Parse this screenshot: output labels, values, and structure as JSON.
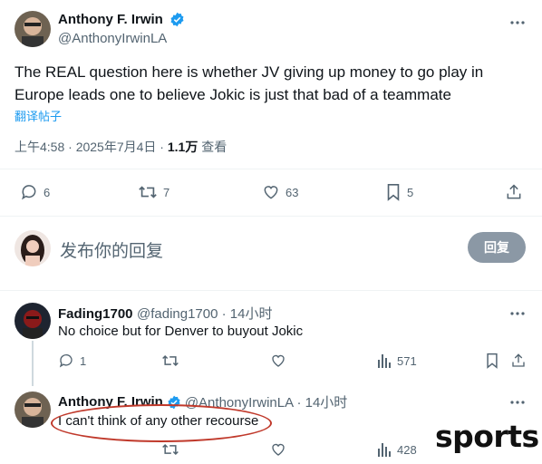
{
  "main_tweet": {
    "author": "Anthony F. Irwin",
    "handle": "@AnthonyIrwinLA",
    "text_line1": "The REAL question here is whether JV giving up money to go play in",
    "text_line2": "Europe leads one to believe Jokic is just that bad of a teammate",
    "translate": "翻译帖子",
    "time": "上午4:58 · 2025年7月4日 · ",
    "views": "1.1万",
    "views_label": " 查看",
    "stats": {
      "replies": "6",
      "retweets": "7",
      "likes": "63",
      "bookmarks": "5"
    }
  },
  "compose": {
    "placeholder": "发布你的回复",
    "button": "回复"
  },
  "reply1": {
    "author": "Fading1700",
    "handle_time": "@fading1700 · 14小时",
    "text": "No choice but for Denver to buyout Jokic",
    "stats": {
      "replies": "1",
      "views": "571"
    }
  },
  "reply2": {
    "author": "Anthony F. Irwin",
    "handle_time": "@AnthonyIrwinLA · 14小时",
    "text": "I can't think of any other recourse",
    "stats": {
      "views": "428"
    }
  },
  "watermark": "sports",
  "colors": {
    "verified": "#1d9bf0",
    "muted": "#536471",
    "annotation": "#c0392b"
  }
}
